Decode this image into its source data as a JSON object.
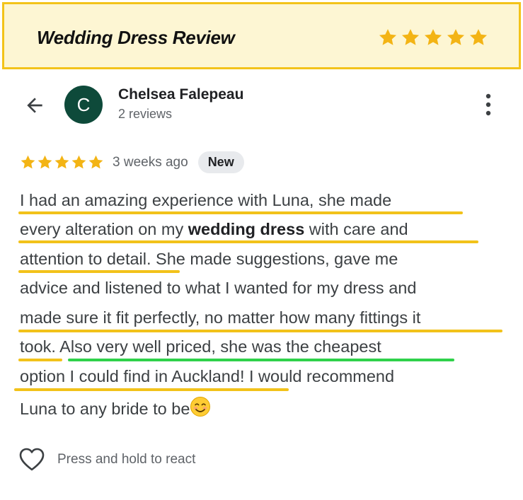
{
  "banner": {
    "title": "Wedding Dress Review",
    "stars": 5
  },
  "reviewer": {
    "initial": "C",
    "name": "Chelsea Falepeau",
    "review_count": "2 reviews"
  },
  "review": {
    "rating": 5,
    "time": "3 weeks ago",
    "badge": "New",
    "lines": [
      {
        "pre": "I had an amazing experience with Luna, she made"
      },
      {
        "pre": "every alteration on my ",
        "bold": "wedding dress",
        "post": " with care and"
      },
      {
        "pre": "attention to detail. She made suggestions, gave me"
      },
      {
        "pre": "advice and listened to what I wanted for my dress and"
      },
      {
        "pre": "made sure it fit perfectly, no matter how many fittings it"
      },
      {
        "pre": "took. Also very well priced, she was the cheapest"
      },
      {
        "pre": "option I could find in Auckland! I would recommend"
      },
      {
        "pre": "Luna to any bride to be"
      }
    ]
  },
  "react": {
    "label": "Press and hold to react"
  },
  "colors": {
    "banner_bg": "#fdf6d3",
    "star": "#f3b415",
    "avatar": "#0e4a3a",
    "highlight_yellow": "#f2c21a",
    "highlight_green": "#2fd14a"
  },
  "icons": {
    "back": "arrow-left-icon",
    "more": "more-vert-icon",
    "react": "heart-outline-icon",
    "emoji": "smiling-face-emoji"
  }
}
